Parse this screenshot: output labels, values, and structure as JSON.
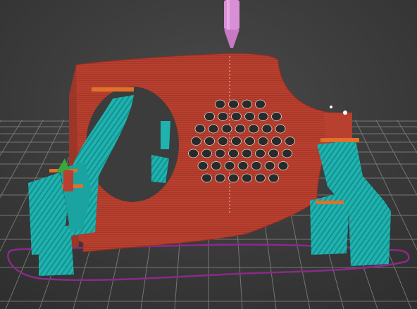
{
  "viewport": {
    "kind": "3d-slicer-layer-preview"
  },
  "scene": {
    "nozzle": {
      "icon": "print-nozzle-icon",
      "color": "#d98fd6"
    },
    "build_plate": {
      "grid_color": "#8a8a8a",
      "background": "#3a3a3a"
    },
    "skirt": {
      "color": "#8a2a8a"
    },
    "model": {
      "name": "",
      "wall_color": "#b8402f",
      "hole_color": "#2a2a2a"
    },
    "supports": {
      "color": "#1fb3b0",
      "stripe_color": "#117a78"
    },
    "overhang_marks": {
      "color": "#e0702a"
    },
    "seam_marks": {
      "color": "#ffffff"
    },
    "vent_holes": {
      "rows": [
        4,
        6,
        7,
        8,
        8,
        7,
        6
      ]
    }
  }
}
